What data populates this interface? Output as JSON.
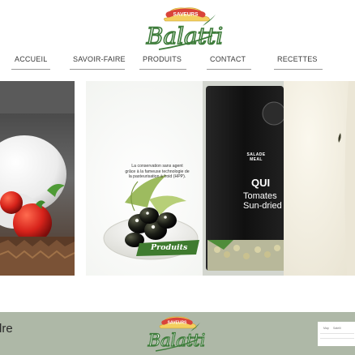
{
  "brand": {
    "badge_text": "SAVEURS",
    "name": "Balatti"
  },
  "nav": {
    "items": [
      {
        "label": "ACCUEIL"
      },
      {
        "label": "SAVOIR-FAIRE"
      },
      {
        "label": "PRODUITS"
      },
      {
        "label": "CONTACT"
      },
      {
        "label": "RECETTES"
      }
    ]
  },
  "slides": {
    "center": {
      "promo_lines": [
        "La conservation sans agent",
        "grâce à la fameuse technologie de",
        "la pasteurisation à froid (HPP)."
      ],
      "cta_label": "Produits"
    },
    "package": {
      "title_lines": [
        "SALADE",
        "MEAL"
      ],
      "badge": "QUI",
      "product_lines": [
        "Tomates",
        "Sun-dried"
      ]
    }
  },
  "footer": {
    "left_text": "dre",
    "brand_name": "Balatti",
    "brand_badge": "SAVEURS",
    "card_labels": [
      "Map",
      "Satelli"
    ]
  },
  "colors": {
    "brand_green": "#3c7a3c",
    "brand_red": "#c0392b",
    "badge_bg": "#f5d46a",
    "footer_bg": "#aeb8a7",
    "package_dark": "#151515",
    "cta_bg": "#3f7b2f"
  }
}
